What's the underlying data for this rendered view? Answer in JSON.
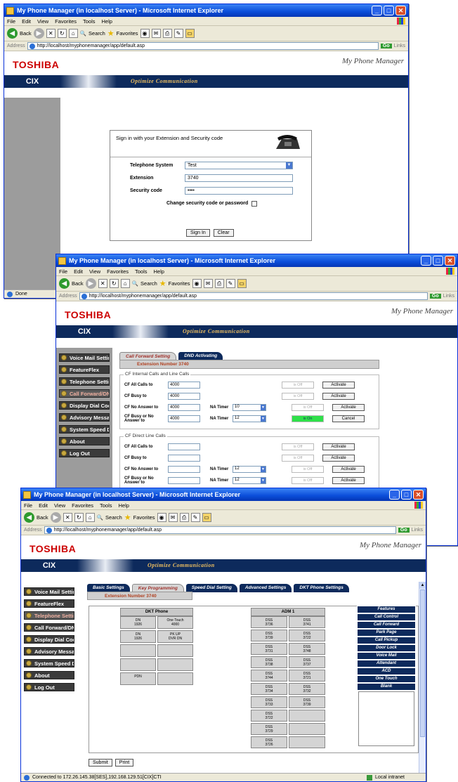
{
  "browser": {
    "title": "My Phone Manager (in localhost Server) - Microsoft Internet Explorer",
    "menus": [
      "File",
      "Edit",
      "View",
      "Favorites",
      "Tools",
      "Help"
    ],
    "back_label": "Back",
    "search_label": "Search",
    "favorites_label": "Favorites",
    "address_label": "Address",
    "url": "http://localhost/myphonemanager/app/default.asp",
    "go_label": "Go",
    "links_label": "Links"
  },
  "brand": {
    "logo": "TOSHIBA",
    "product": "CIX",
    "app_name": "My Phone Manager",
    "slogan": "Optimize Communication"
  },
  "nav": {
    "items": [
      "Voice Mail Setting",
      "FeatureFlex",
      "Telephone Setting",
      "Call Forward/DND",
      "Display Dial Code",
      "Advisory Message",
      "System Speed Dial",
      "About",
      "Log Out"
    ]
  },
  "login": {
    "prompt": "Sign in with your Extension and Security code",
    "system_label": "Telephone System",
    "system_value": "Test",
    "extension_label": "Extension",
    "extension_value": "3740",
    "security_label": "Security code",
    "security_value": "••••",
    "change_label": "Change security code or password",
    "signin_label": "Sign In",
    "clear_label": "Clear",
    "status": "Done"
  },
  "callforward": {
    "tabs": [
      "Call Forward Setting",
      "DND Activating"
    ],
    "extension_bar": "Extension Number 3740",
    "internal_legend": "CF Internal Calls and Line Calls",
    "direct_legend": "CF Direct Line Calls",
    "na_timer_label": "NA Timer",
    "status_off": "is Off",
    "status_on": "is On",
    "activate_label": "Activate",
    "cancel_label": "Cancel",
    "internal_rows": [
      {
        "label": "CF All Calls to",
        "value": "4000"
      },
      {
        "label": "CF Busy to",
        "value": "4000"
      },
      {
        "label": "CF No Answer to",
        "value": "4000",
        "timer": "10"
      },
      {
        "label": "CF Busy or No Answer to",
        "value": "4000",
        "timer": "12"
      }
    ],
    "direct_rows": [
      {
        "label": "CF All Calls to",
        "value": ""
      },
      {
        "label": "CF Busy to",
        "value": ""
      },
      {
        "label": "CF No Answer to",
        "value": "",
        "timer": "12"
      },
      {
        "label": "CF Busy or No Answer to",
        "value": "",
        "timer": "12"
      }
    ]
  },
  "keyprog": {
    "tabs": [
      "Basic Settings",
      "Key Programming",
      "Speed Dial Setting",
      "Advanced Settings",
      "DKT Phone Settings"
    ],
    "extension_bar": "Extension Number 3740",
    "dkt_title": "DKT Phone",
    "dkt_keys": [
      [
        "DN",
        "1926"
      ],
      [
        "One Touch",
        "4000"
      ],
      [
        "DN",
        "1926"
      ],
      [
        "PK UP",
        "DVR DN"
      ],
      [
        "",
        ""
      ],
      [
        "",
        ""
      ],
      [
        "",
        ""
      ],
      [
        "",
        ""
      ],
      [
        "PDN",
        ""
      ],
      [
        "",
        ""
      ]
    ],
    "adm_title": "ADM 1",
    "adm_keys": [
      [
        "DSS",
        "3736"
      ],
      [
        "DSS",
        "3741"
      ],
      [
        "DSS",
        "3739"
      ],
      [
        "DSS",
        "3722"
      ],
      [
        "DSS",
        "3731"
      ],
      [
        "DSS",
        "3748"
      ],
      [
        "DSS",
        "3738"
      ],
      [
        "DSS",
        "3737"
      ],
      [
        "DSS",
        "3744"
      ],
      [
        "DSS",
        "3721"
      ],
      [
        "DSS",
        "3734"
      ],
      [
        "DSS",
        "3732"
      ],
      [
        "DSS",
        "3733"
      ],
      [
        "DSS",
        "3739"
      ],
      [
        "DSS",
        "3722"
      ],
      [
        "",
        ""
      ],
      [
        "DSS",
        "3729"
      ],
      [
        "",
        ""
      ],
      [
        "DSS",
        "3726"
      ],
      [
        "",
        ""
      ]
    ],
    "features": [
      "Features",
      "Call Control",
      "Call Forward",
      "Park Page",
      "Call Pickup",
      "Door Lock",
      "Voice Mail",
      "Attendant",
      "ACD",
      "One Touch",
      "Blank"
    ],
    "submit_label": "Submit",
    "print_label": "Print",
    "status": "Connected to 172.26.145.38[SES],192.168.129.51[CIX]CTI",
    "zone": "Local intranet"
  }
}
